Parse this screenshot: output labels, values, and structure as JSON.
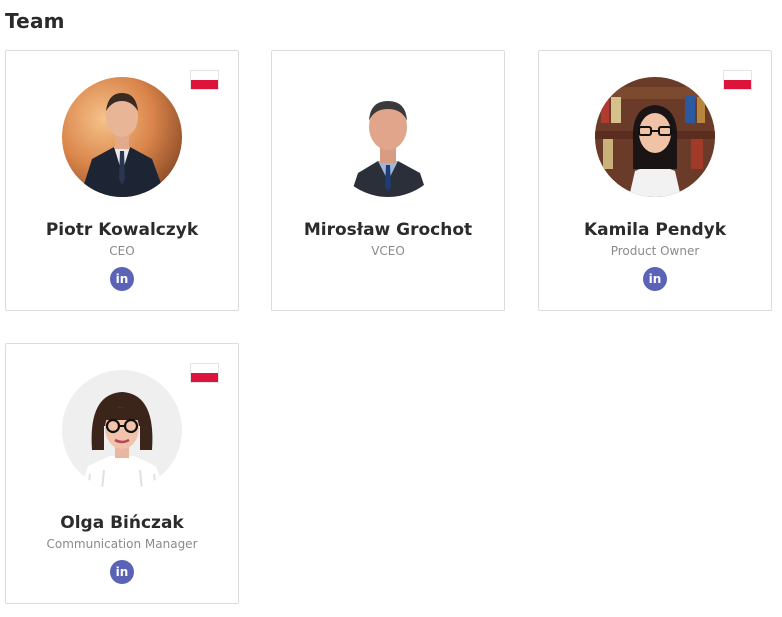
{
  "section": {
    "title": "Team"
  },
  "members": [
    {
      "name": "Piotr Kowalczyk",
      "role": "CEO",
      "has_flag": true,
      "has_linkedin": true,
      "linkedin_icon": "linkedin-icon"
    },
    {
      "name": "Mirosław Grochot",
      "role": "VCEO",
      "has_flag": false,
      "has_linkedin": false
    },
    {
      "name": "Kamila Pendyk",
      "role": "Product Owner",
      "has_flag": true,
      "has_linkedin": true,
      "linkedin_icon": "linkedin-icon"
    },
    {
      "name": "Olga Bińczak",
      "role": "Communication Manager",
      "has_flag": true,
      "has_linkedin": true,
      "linkedin_icon": "linkedin-icon"
    }
  ],
  "icons": {
    "linkedin_glyph": "in",
    "flag": "poland-flag-icon"
  },
  "colors": {
    "linkedin": "#5b63b7",
    "flag_red": "#dc143c"
  }
}
